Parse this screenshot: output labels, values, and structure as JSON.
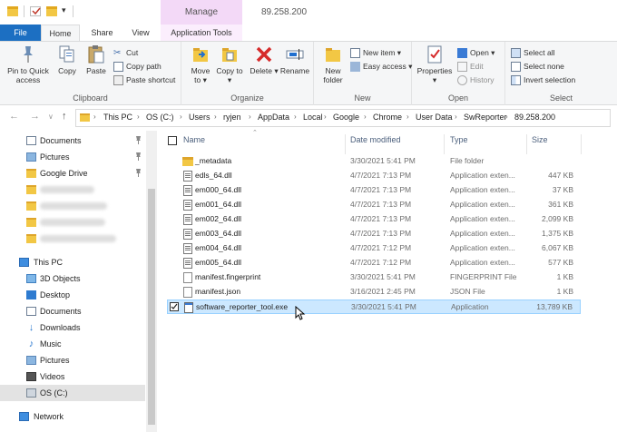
{
  "window": {
    "title": "89.258.200",
    "manage_tab": "Manage"
  },
  "tabs": {
    "file": "File",
    "home": "Home",
    "share": "Share",
    "view": "View",
    "application_tools": "Application Tools"
  },
  "ribbon": {
    "clipboard": {
      "label": "Clipboard",
      "pin": "Pin to Quick access",
      "copy": "Copy",
      "paste": "Paste",
      "cut": "Cut",
      "copy_path": "Copy path",
      "paste_shortcut": "Paste shortcut"
    },
    "organize": {
      "label": "Organize",
      "move_to": "Move to",
      "copy_to": "Copy to",
      "delete": "Delete",
      "rename": "Rename"
    },
    "new": {
      "label": "New",
      "new_folder": "New folder",
      "new_item": "New item",
      "easy_access": "Easy access"
    },
    "open": {
      "label": "Open",
      "properties": "Properties",
      "open": "Open",
      "edit": "Edit",
      "history": "History"
    },
    "select": {
      "label": "Select",
      "select_all": "Select all",
      "select_none": "Select none",
      "invert_selection": "Invert selection"
    }
  },
  "address": {
    "crumbs": [
      "This PC",
      "OS (C:)",
      "Users",
      "ryjen",
      "AppData",
      "Local",
      "Google",
      "Chrome",
      "User Data",
      "SwReporter",
      "89.258.200"
    ]
  },
  "nav_pane": {
    "quick_access": [
      "Documents",
      "Pictures",
      "Google Drive"
    ],
    "this_pc": "This PC",
    "this_pc_items": [
      "3D Objects",
      "Desktop",
      "Documents",
      "Downloads",
      "Music",
      "Pictures",
      "Videos",
      "OS (C:)"
    ],
    "network": "Network"
  },
  "columns": {
    "name": "Name",
    "date": "Date modified",
    "type": "Type",
    "size": "Size"
  },
  "files": [
    {
      "name": "_metadata",
      "date": "3/30/2021 5:41 PM",
      "type": "File folder",
      "size": "",
      "kind": "folder"
    },
    {
      "name": "edls_64.dll",
      "date": "4/7/2021 7:13 PM",
      "type": "Application exten...",
      "size": "447 KB",
      "kind": "dll"
    },
    {
      "name": "em000_64.dll",
      "date": "4/7/2021 7:13 PM",
      "type": "Application exten...",
      "size": "37 KB",
      "kind": "dll"
    },
    {
      "name": "em001_64.dll",
      "date": "4/7/2021 7:13 PM",
      "type": "Application exten...",
      "size": "361 KB",
      "kind": "dll"
    },
    {
      "name": "em002_64.dll",
      "date": "4/7/2021 7:13 PM",
      "type": "Application exten...",
      "size": "2,099 KB",
      "kind": "dll"
    },
    {
      "name": "em003_64.dll",
      "date": "4/7/2021 7:13 PM",
      "type": "Application exten...",
      "size": "1,375 KB",
      "kind": "dll"
    },
    {
      "name": "em004_64.dll",
      "date": "4/7/2021 7:12 PM",
      "type": "Application exten...",
      "size": "6,067 KB",
      "kind": "dll"
    },
    {
      "name": "em005_64.dll",
      "date": "4/7/2021 7:12 PM",
      "type": "Application exten...",
      "size": "577 KB",
      "kind": "dll"
    },
    {
      "name": "manifest.fingerprint",
      "date": "3/30/2021 5:41 PM",
      "type": "FINGERPRINT File",
      "size": "1 KB",
      "kind": "doc"
    },
    {
      "name": "manifest.json",
      "date": "3/16/2021 2:45 PM",
      "type": "JSON File",
      "size": "1 KB",
      "kind": "doc"
    },
    {
      "name": "software_reporter_tool.exe",
      "date": "3/30/2021 5:41 PM",
      "type": "Application",
      "size": "13,789 KB",
      "kind": "exe",
      "selected": true
    }
  ]
}
